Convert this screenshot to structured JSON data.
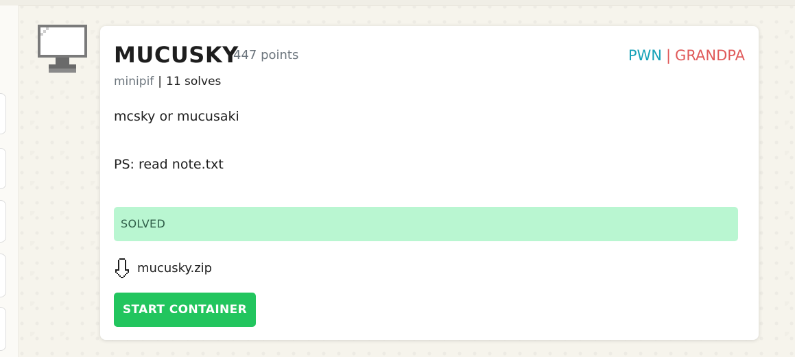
{
  "challenge": {
    "title": "MUCUSKY",
    "points": "447 points",
    "category": "PWN",
    "tag_separator": "|",
    "difficulty": "GRANDPA",
    "author": "minipif",
    "meta_separator": "|",
    "solves": "11 solves",
    "description": [
      "mcsky or mucusaki",
      "PS: read note.txt"
    ],
    "status": "SOLVED",
    "attachment": "mucusky.zip",
    "start_button_label": "START CONTAINER"
  },
  "icons": {
    "category_icon": "monitor-icon",
    "attachment_icon": "download-icon"
  },
  "colors": {
    "category": "#17a2b8",
    "difficulty": "#e05a5a",
    "status_background": "#b9f6d1",
    "button": "#22c55e",
    "muted": "#6c757d"
  }
}
